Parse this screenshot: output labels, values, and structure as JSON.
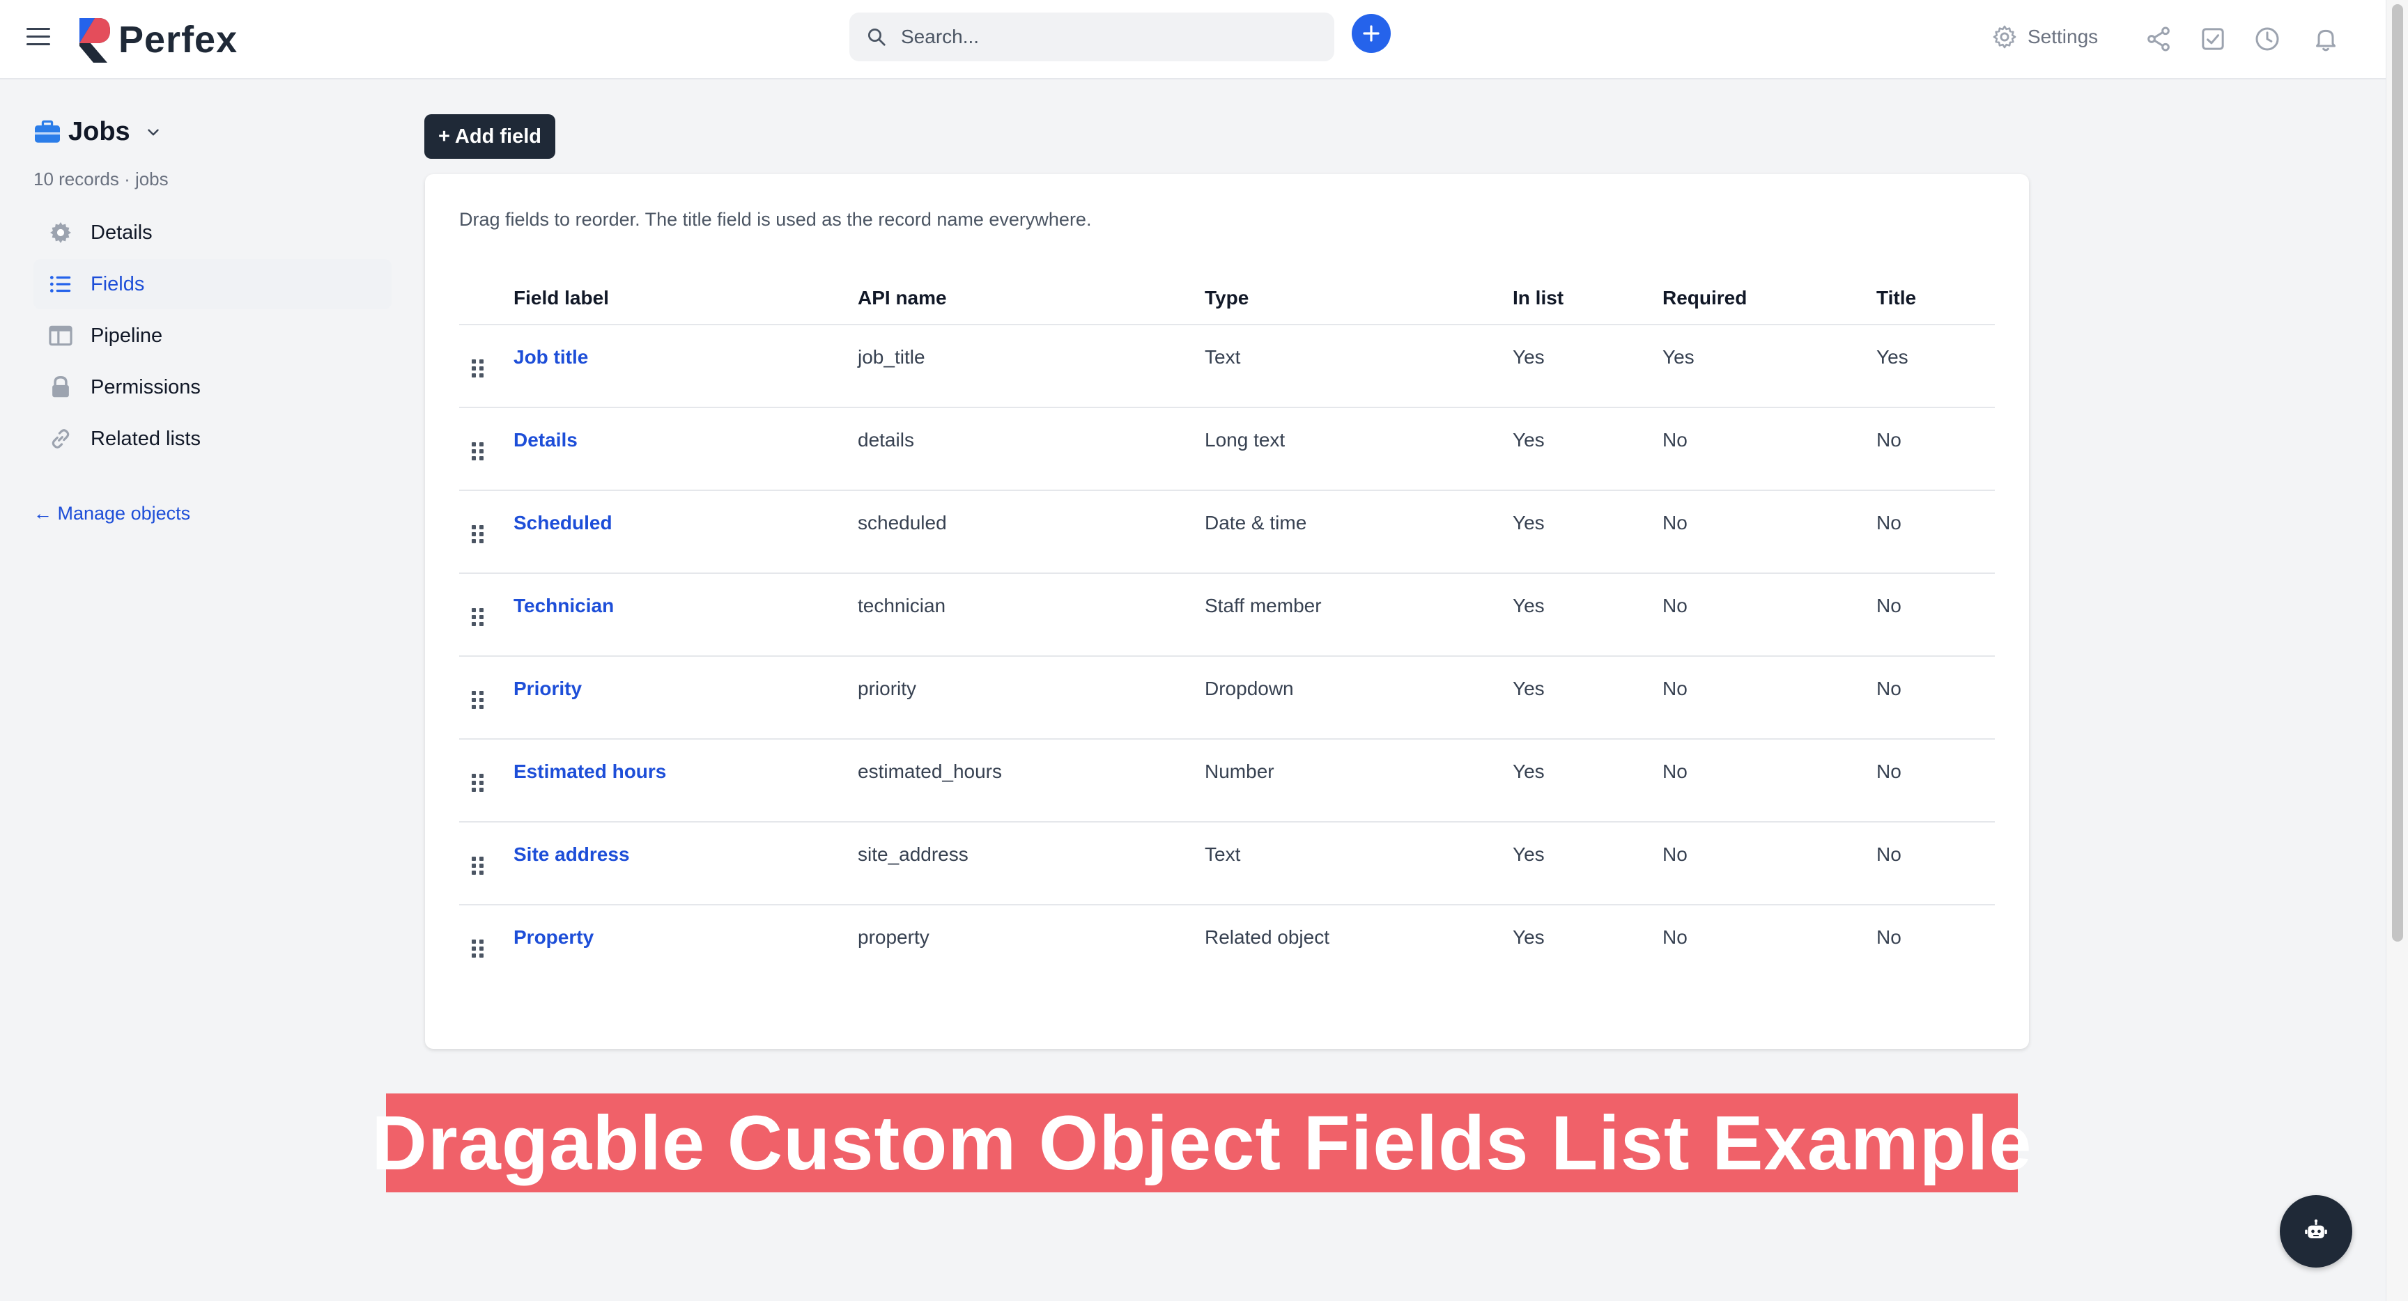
{
  "topbar": {
    "brand": "Perfex",
    "search_placeholder": "Search...",
    "settings_label": "Settings",
    "accent_color": "#2563eb"
  },
  "sidebar": {
    "object_name": "Jobs",
    "object_sub": "10 records · jobs",
    "items": [
      {
        "label": "Details",
        "icon": "gear-icon"
      },
      {
        "label": "Fields",
        "icon": "list-icon",
        "active": true
      },
      {
        "label": "Pipeline",
        "icon": "columns-icon"
      },
      {
        "label": "Permissions",
        "icon": "lock-icon"
      },
      {
        "label": "Related lists",
        "icon": "link-icon"
      }
    ],
    "manage_link": "← Manage objects"
  },
  "main": {
    "add_field_label": "+ Add field",
    "hint": "Drag fields to reorder. The title field is used as the record name everywhere.",
    "columns": [
      "Field label",
      "API name",
      "Type",
      "In list",
      "Required",
      "Title"
    ],
    "rows": [
      {
        "label": "Job title",
        "api": "job_title",
        "type": "Text",
        "in_list": "Yes",
        "required": "Yes",
        "title": "Yes"
      },
      {
        "label": "Details",
        "api": "details",
        "type": "Long text",
        "in_list": "Yes",
        "required": "No",
        "title": "No"
      },
      {
        "label": "Scheduled",
        "api": "scheduled",
        "type": "Date & time",
        "in_list": "Yes",
        "required": "No",
        "title": "No"
      },
      {
        "label": "Technician",
        "api": "technician",
        "type": "Staff member",
        "in_list": "Yes",
        "required": "No",
        "title": "No"
      },
      {
        "label": "Priority",
        "api": "priority",
        "type": "Dropdown",
        "in_list": "Yes",
        "required": "No",
        "title": "No"
      },
      {
        "label": "Estimated hours",
        "api": "estimated_hours",
        "type": "Number",
        "in_list": "Yes",
        "required": "No",
        "title": "No"
      },
      {
        "label": "Site address",
        "api": "site_address",
        "type": "Text",
        "in_list": "Yes",
        "required": "No",
        "title": "No"
      },
      {
        "label": "Property",
        "api": "property",
        "type": "Related object",
        "in_list": "Yes",
        "required": "No",
        "title": "No"
      }
    ]
  },
  "banner": {
    "text": "Dragable Custom Object Fields List Example",
    "color": "#f06169"
  }
}
